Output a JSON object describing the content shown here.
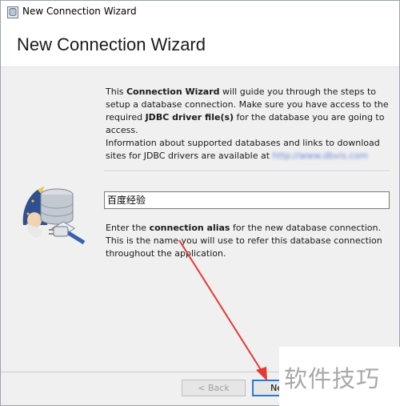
{
  "window": {
    "title": "New Connection Wizard"
  },
  "header": {
    "heading": "New Connection Wizard"
  },
  "info": {
    "line1_pre": "This ",
    "line1_bold": "Connection Wizard",
    "line1_post": " will guide you through the steps to setup a database connection. Make sure you have access to the required ",
    "line1_bold2": "JDBC driver file(s)",
    "line1_end": " for the database you are going to access.",
    "line2": "Information about supported databases and links to download sites for JDBC drivers are available at ",
    "url": "http://www.dbvis.com"
  },
  "alias": {
    "value": "百度经验",
    "desc_pre": "Enter the ",
    "desc_bold": "connection alias",
    "desc_post": " for the new database connection. This is the name you will use to refer this database connection throughout the application."
  },
  "footer": {
    "back_label": "< Back",
    "next_label": "Next"
  },
  "watermark": {
    "text": "软件技巧"
  },
  "colors": {
    "accent_border": "#2b79d6",
    "annotation_arrow": "#e53935"
  },
  "icons": {
    "title": "database-app-icon",
    "wizard": "wizard-database-plug-icon"
  }
}
